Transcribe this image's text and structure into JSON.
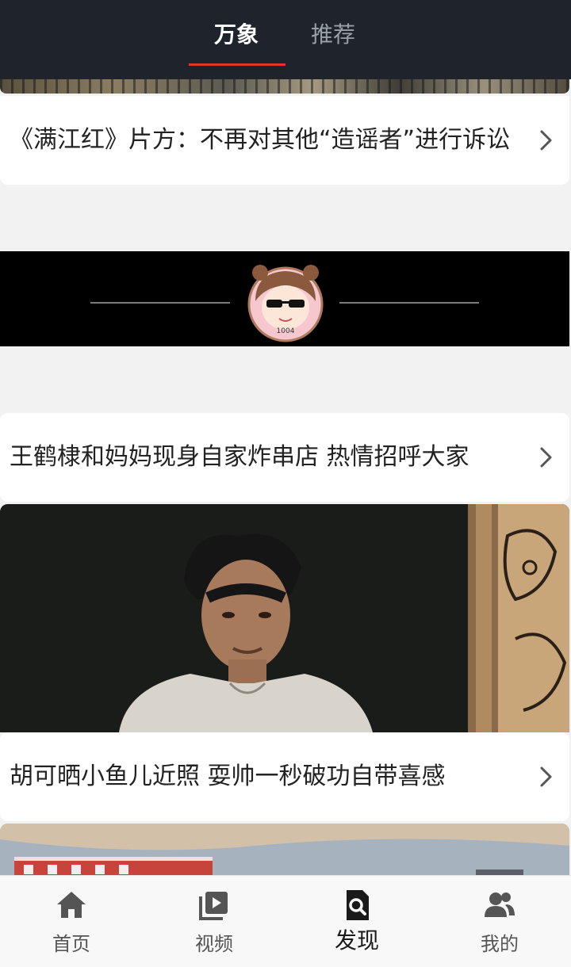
{
  "header": {
    "tabs": [
      {
        "label": "万象",
        "active": true
      },
      {
        "label": "推荐",
        "active": false
      }
    ],
    "accent_color": "#e0342c"
  },
  "feed": {
    "items": [
      {
        "title": "《满江红》片方：不再对其他“造谣者”进行诉讼"
      },
      {
        "title": "王鹤棣和妈妈现身自家炸串店 热情招呼大家"
      },
      {
        "title": "胡可晒小鱼儿近照 耍帅一秒破功自带喜感"
      }
    ],
    "ad_banner": {
      "avatar_caption": "1004"
    }
  },
  "bottom_nav": {
    "items": [
      {
        "label": "首页",
        "icon": "home-icon"
      },
      {
        "label": "视频",
        "icon": "video-icon"
      },
      {
        "label": "发现",
        "icon": "discover-icon",
        "active": true
      },
      {
        "label": "我的",
        "icon": "user-group-icon"
      }
    ]
  }
}
